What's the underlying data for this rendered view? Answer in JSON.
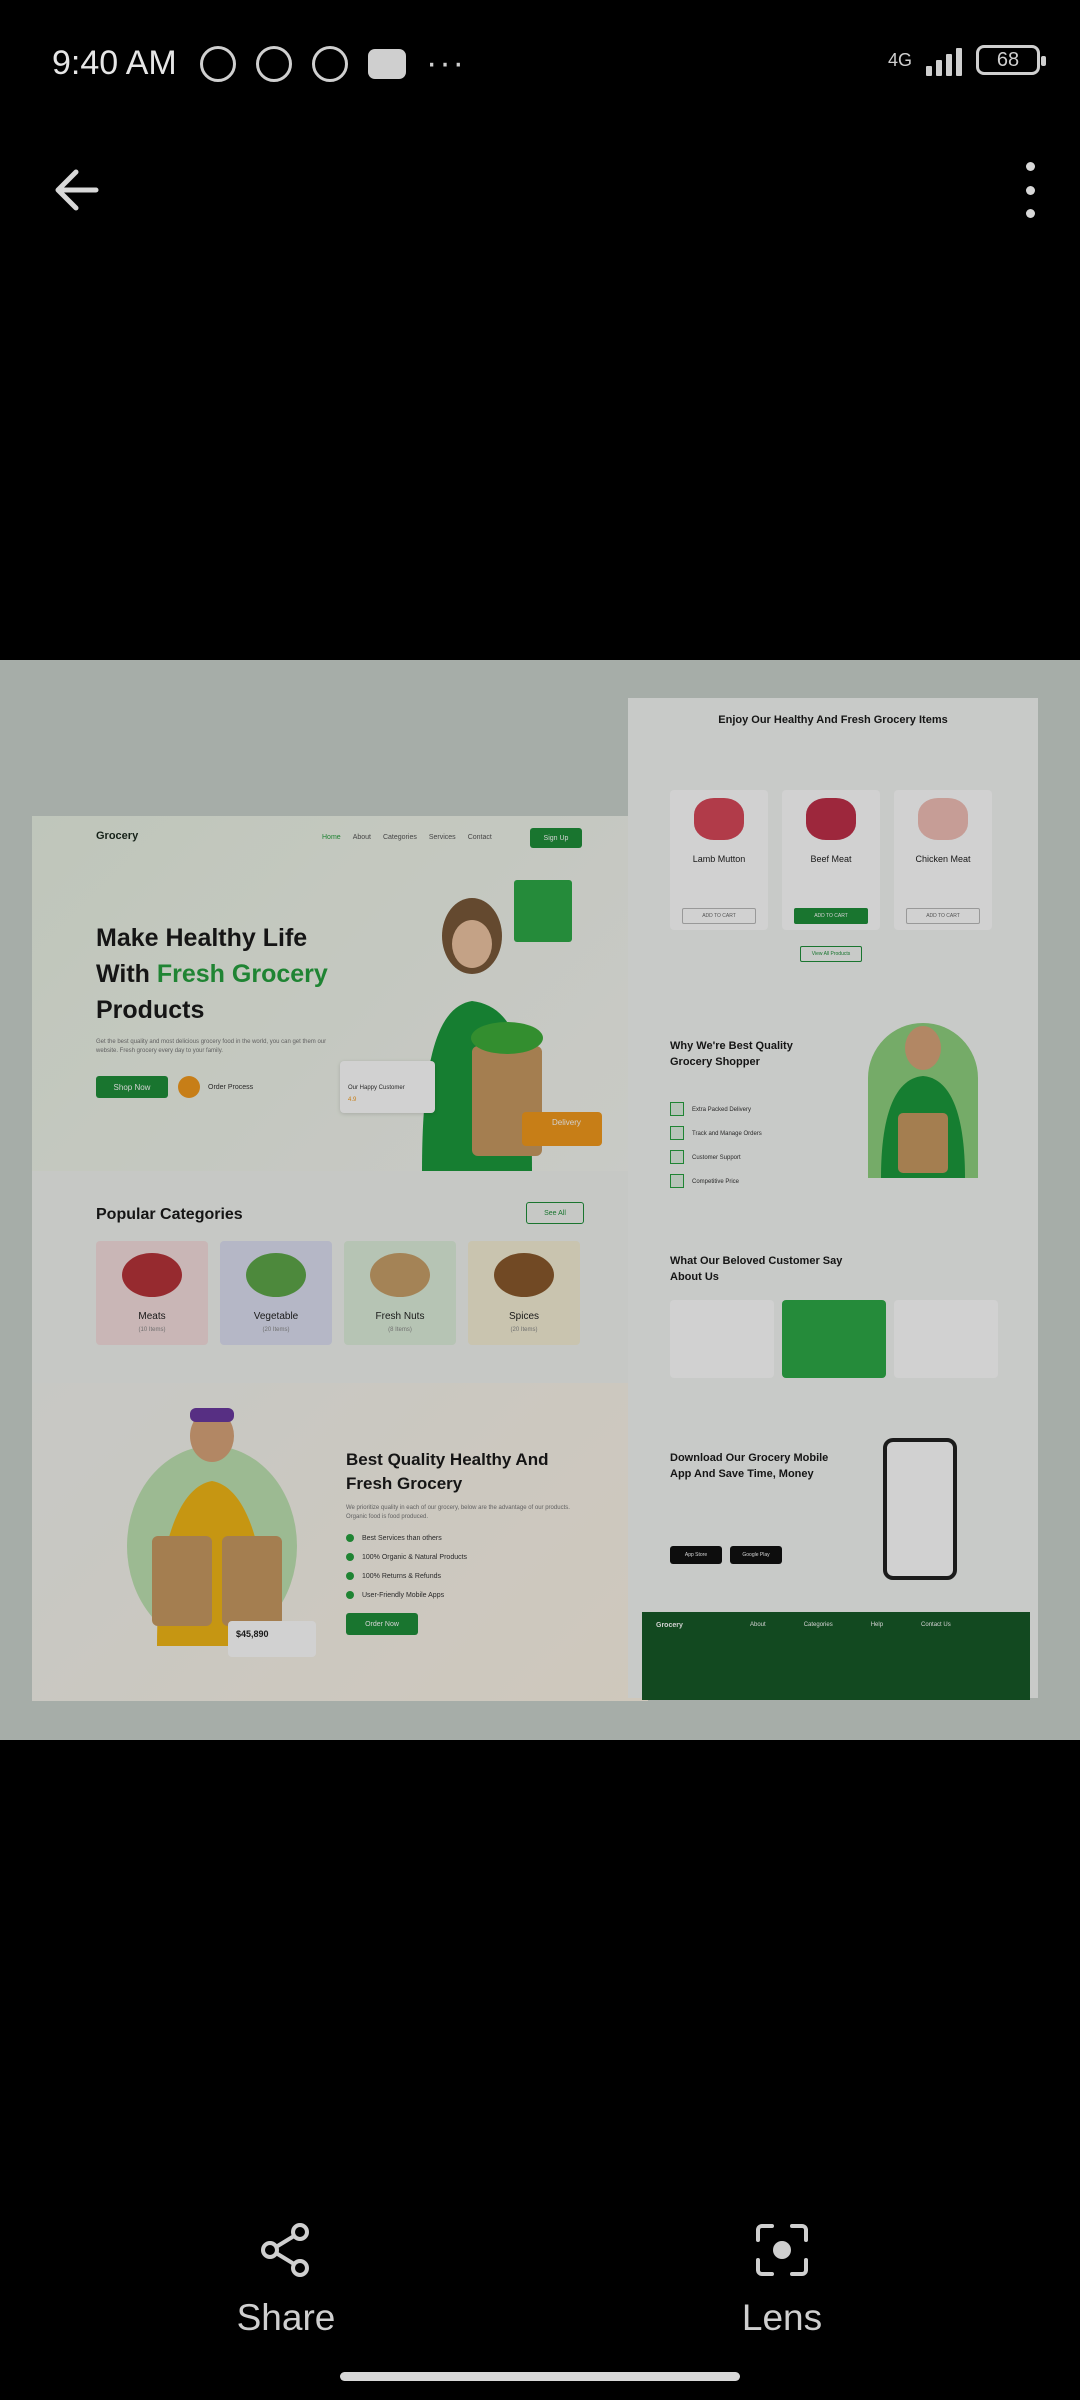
{
  "status_bar": {
    "time": "9:40 AM",
    "network": "4G",
    "battery": "68"
  },
  "landing": {
    "brand": "Grocery",
    "nav": [
      "Home",
      "About",
      "Categories",
      "Services",
      "Contact"
    ],
    "signup": "Sign Up",
    "hero_line1": "Make Healthy Life",
    "hero_line2a": "With ",
    "hero_line2b": "Fresh Grocery",
    "hero_line3": "Products",
    "hero_sub": "Get the best quality and most delicious grocery food in the world, you can get them our website. Fresh grocery every day to your family.",
    "shop_now": "Shop Now",
    "order_process": "Order Process",
    "happy_customer": "Our Happy Customer",
    "rating": "4.9",
    "delivery": "Delivery",
    "popular_title": "Popular Categories",
    "see_all": "See All",
    "categories": [
      {
        "name": "Meats",
        "count": "(10 Items)"
      },
      {
        "name": "Vegetable",
        "count": "(20 Items)"
      },
      {
        "name": "Fresh Nuts",
        "count": "(8 Items)"
      },
      {
        "name": "Spices",
        "count": "(20 Items)"
      }
    ],
    "bq_title": "Best Quality Healthy And Fresh Grocery",
    "bq_sub": "We prioritize quality in each of our grocery, below are the advantage of our products. Organic food is food produced.",
    "bq_list": [
      "Best Services than others",
      "100% Organic & Natural Products",
      "100% Returns & Refunds",
      "User-Friendly Mobile Apps"
    ],
    "order_now": "Order Now",
    "money_label": "$45,890"
  },
  "right_page": {
    "title": "Enjoy Our Healthy And Fresh Grocery Items",
    "products": [
      {
        "name": "Lamb Mutton",
        "button": "ADD TO CART"
      },
      {
        "name": "Beef Meat",
        "button": "ADD TO CART"
      },
      {
        "name": "Chicken Meat",
        "button": "ADD TO CART"
      }
    ],
    "view_all": "View All Products",
    "why_title": "Why We're Best Quality Grocery Shopper",
    "why_list": [
      "Extra Packed Delivery",
      "Track and Manage Orders",
      "Customer Support",
      "Competitive Price"
    ],
    "cust_title": "What Our Beloved Customer Say About Us",
    "dl_title": "Download Our Grocery Mobile App And Save Time, Money",
    "stores": [
      "App Store",
      "Google Play"
    ],
    "footer_brand": "Grocery",
    "footer_cols": [
      "About",
      "Categories",
      "Help",
      "Contact Us"
    ]
  },
  "actions": {
    "share": "Share",
    "lens": "Lens"
  },
  "colors": {
    "accent": "#1f8f3a",
    "orange": "#f39a1d"
  }
}
